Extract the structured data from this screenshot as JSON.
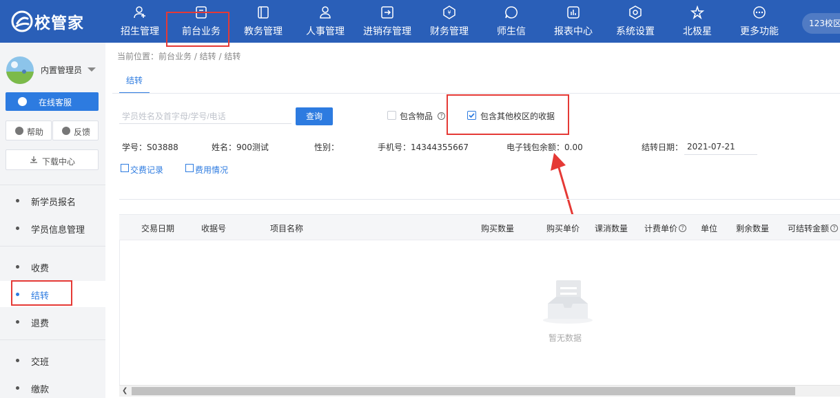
{
  "app": {
    "logo_text": "校管家",
    "campus": "123校区"
  },
  "nav": {
    "items": [
      {
        "label": "招生管理",
        "icon": "add-person-icon"
      },
      {
        "label": "前台业务",
        "icon": "front-desk-icon"
      },
      {
        "label": "教务管理",
        "icon": "book-icon"
      },
      {
        "label": "人事管理",
        "icon": "person-icon"
      },
      {
        "label": "进销存管理",
        "icon": "inventory-icon"
      },
      {
        "label": "财务管理",
        "icon": "finance-icon"
      },
      {
        "label": "师生信",
        "icon": "message-icon"
      },
      {
        "label": "报表中心",
        "icon": "report-icon"
      },
      {
        "label": "系统设置",
        "icon": "settings-icon"
      },
      {
        "label": "北极星",
        "icon": "star-icon"
      },
      {
        "label": "更多功能",
        "icon": "more-icon"
      }
    ],
    "active": "前台业务"
  },
  "sidebar": {
    "user_name": "内置管理员",
    "service_button": "在线客服",
    "help_button": "帮助",
    "feedback_button": "反馈",
    "download_button": "下载中心",
    "items": [
      {
        "label": "新学员报名"
      },
      {
        "label": "学员信息管理"
      },
      {
        "label": "收费"
      },
      {
        "label": "结转"
      },
      {
        "label": "退费"
      },
      {
        "label": "交班"
      },
      {
        "label": "缴款"
      }
    ],
    "active": "结转"
  },
  "breadcrumb": "当前位置：前台业务 / 结转 / 结转",
  "tab": {
    "label": "结转"
  },
  "search": {
    "placeholder": "学员姓名及首字母/学号/电话",
    "button": "查询"
  },
  "filters": {
    "include_items": {
      "label": "包含物品",
      "checked": false
    },
    "include_other_campus": {
      "label": "包含其他校区的收据",
      "checked": true
    }
  },
  "student": {
    "id": "学号：S03888",
    "name": "姓名：900测试",
    "gender": "性别：",
    "phone": "手机号：14344355667",
    "wallet": "电子钱包余额：0.00",
    "transfer_date_label": "结转日期：",
    "transfer_date": "2021-07-21"
  },
  "links": {
    "records": "交费记录",
    "fees": "费用情况"
  },
  "table": {
    "headers": [
      "交易日期",
      "收据号",
      "项目名称",
      "购买数量",
      "购买单价",
      "课消数量",
      "计费单价",
      "单位",
      "剩余数量",
      "可结转金额"
    ],
    "empty_text": "暂无数据"
  },
  "colors": {
    "nav_bg": "#2a5fb8",
    "accent": "#2d7be0",
    "highlight": "#e53935"
  }
}
